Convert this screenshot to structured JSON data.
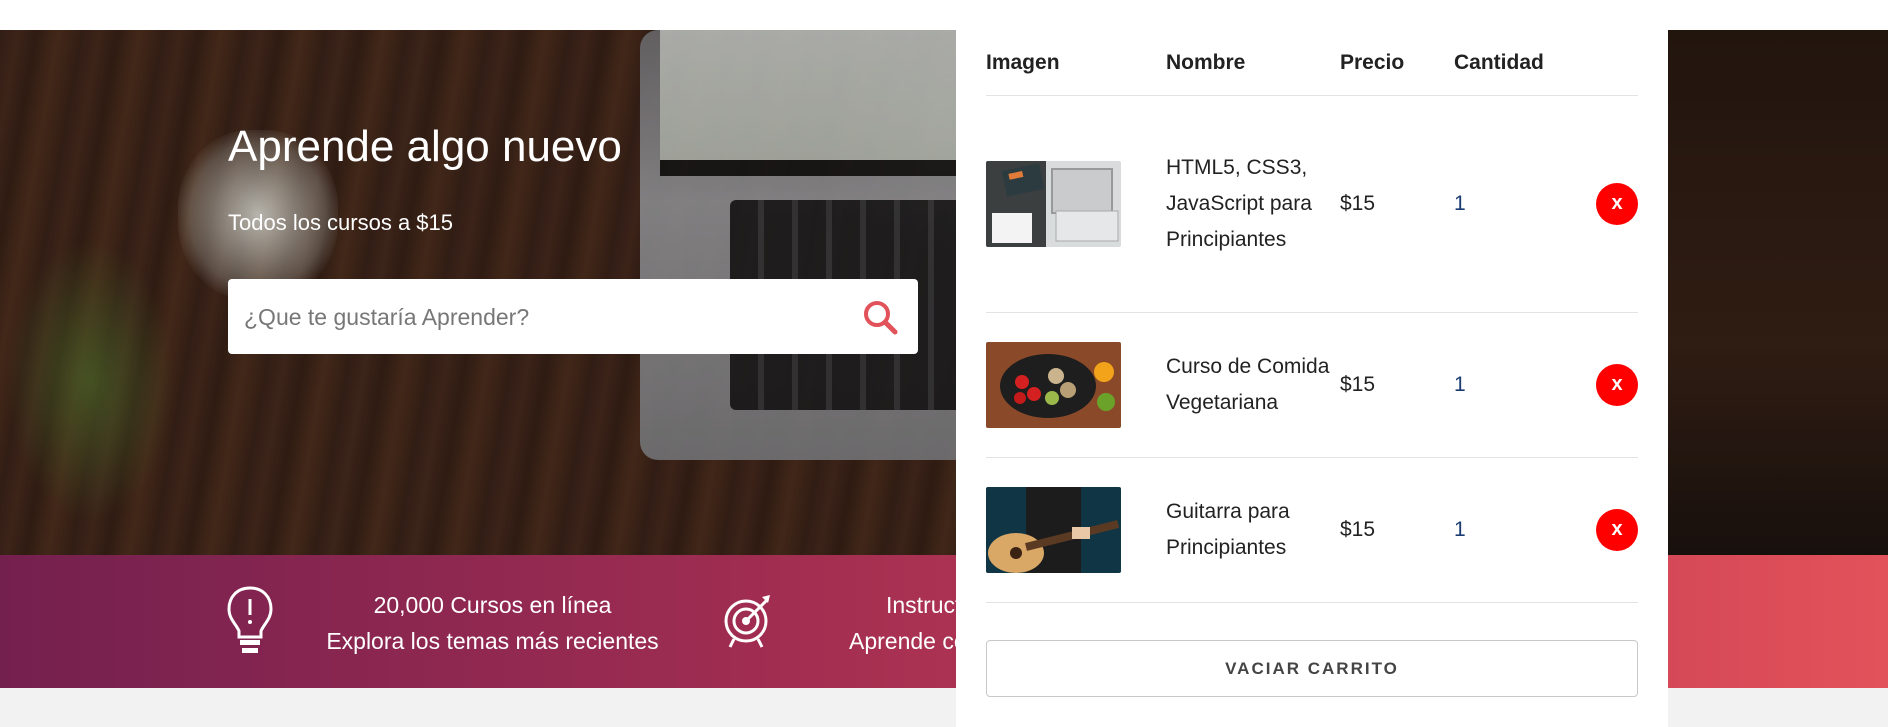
{
  "hero": {
    "title": "Aprende algo nuevo",
    "subtitle": "Todos los cursos a $15",
    "search_placeholder": "¿Que te gustaría Aprender?"
  },
  "features": [
    {
      "icon": "lightbulb-icon",
      "line1": "20,000 Cursos en línea",
      "line2": "Explora los temas más recientes"
    },
    {
      "icon": "target-icon",
      "line1": "Instruct",
      "line2": "Aprende co"
    }
  ],
  "cart": {
    "headers": {
      "image": "Imagen",
      "name": "Nombre",
      "price": "Precio",
      "quantity": "Cantidad"
    },
    "items": [
      {
        "name": "HTML5, CSS3, JavaScript para Principiantes",
        "price": "$15",
        "quantity": "1",
        "remove": "x"
      },
      {
        "name": "Curso de Comida Vegetariana",
        "price": "$15",
        "quantity": "1",
        "remove": "x"
      },
      {
        "name": "Guitarra para Principiantes",
        "price": "$15",
        "quantity": "1",
        "remove": "x"
      }
    ],
    "empty_label": "VACIAR CARRITO"
  },
  "colors": {
    "accent": "#e2525a",
    "band_start": "#74204f",
    "remove_button": "#ff0000"
  }
}
